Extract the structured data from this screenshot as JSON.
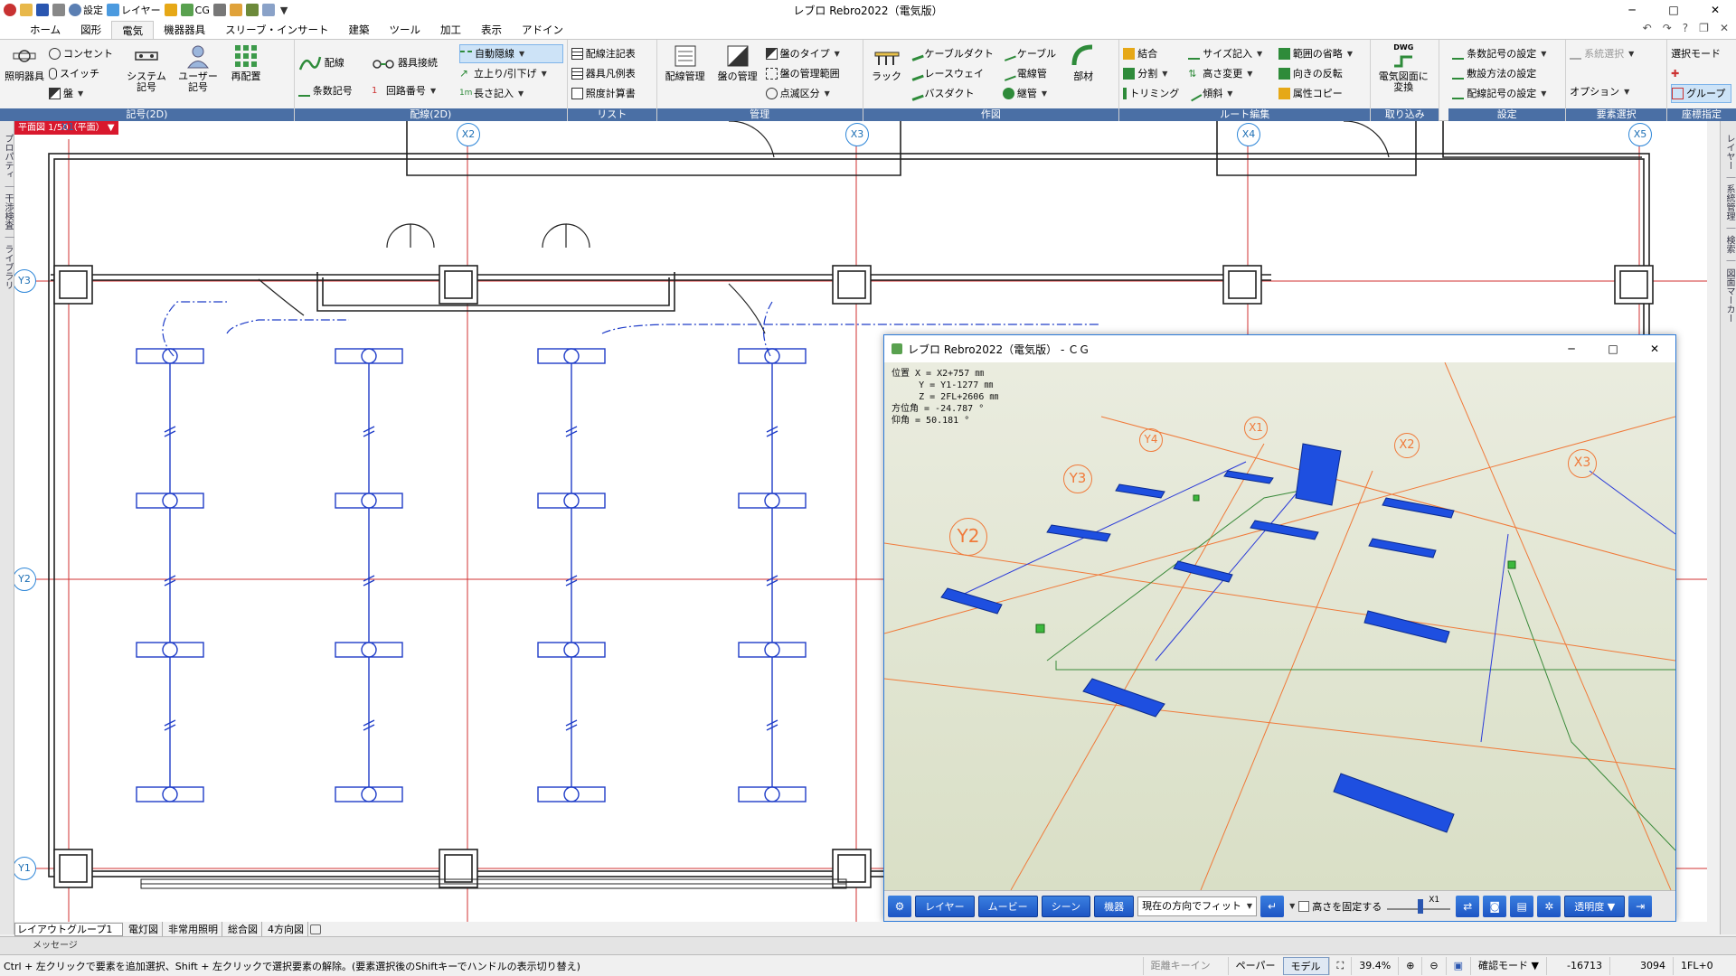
{
  "window": {
    "title": "レブロ Rebro2022（電気版）",
    "quick_access": [
      "設定",
      "レイヤー",
      "CG"
    ]
  },
  "menu_tabs": [
    "ホーム",
    "図形",
    "電気",
    "機器器具",
    "スリーブ・インサート",
    "建築",
    "ツール",
    "加工",
    "表示",
    "アドイン"
  ],
  "active_tab": "電気",
  "ribbon": {
    "kigou": {
      "label": "記号(2D)",
      "big": [
        "照明器具",
        "システム記号",
        "ユーザー記号",
        "再配置"
      ],
      "small": [
        "コンセント",
        "スイッチ",
        "盤"
      ]
    },
    "haisen": {
      "label": "配線(2D)",
      "big": [
        "配線",
        "器具接続"
      ],
      "small": [
        "自動隠線",
        "立上り/引下げ",
        "長さ記入",
        "条数記号",
        "回路番号"
      ]
    },
    "list": {
      "label": "リスト",
      "small": [
        "配線注記表",
        "器具凡例表",
        "照度計算書"
      ]
    },
    "kanri": {
      "label": "管理",
      "big": [
        "配線管理",
        "盤の管理"
      ],
      "small": [
        "盤のタイプ",
        "盤の管理範囲",
        "点滅区分"
      ]
    },
    "sakuzu": {
      "label": "作図",
      "big": [
        "ラック",
        "部材"
      ],
      "small": [
        "ケーブルダクト",
        "ケーブル",
        "レースウェイ",
        "電線管",
        "バスダクト",
        "継管"
      ]
    },
    "route": {
      "label": "ルート編集",
      "small": [
        "結合",
        "サイズ記入",
        "範囲の省略",
        "分割",
        "高さ変更",
        "向きの反転",
        "トリミング",
        "傾斜",
        "属性コピー"
      ]
    },
    "torikomi": {
      "label": "取り込み",
      "big": [
        "電気図面に変換"
      ],
      "badge": "DWG"
    },
    "settei": {
      "label": "設定",
      "small": [
        "条数記号の設定",
        "敷設方法の設定",
        "配線記号の設定"
      ]
    },
    "youso": {
      "label": "要素選択",
      "small": [
        "系統選択",
        "オプション"
      ]
    },
    "zahyo": {
      "label": "座標指定",
      "small": [
        "選択モード",
        "グループ"
      ]
    }
  },
  "left_rail": "プロパティ ｜ 干渉検査 ｜ ライブラリ",
  "right_rail": "レイヤー ｜ 系統管理 ｜ 検索 ｜ 図面マーカー",
  "view_tag": "平面図 1/50（平面）",
  "grid_labels": {
    "x": [
      "X1",
      "X2",
      "X3",
      "X4",
      "X5"
    ],
    "y": [
      "Y1",
      "Y2",
      "Y3"
    ]
  },
  "cg_window": {
    "title": "レブロ Rebro2022（電気版） - ＣＧ",
    "info_lines": [
      "位置 X = X2+757 ㎜",
      "     Y = Y1-1277 ㎜",
      "     Z = 2FL+2606 ㎜",
      "方位角 = -24.787 °",
      "仰角 = 50.181 °"
    ],
    "grid_labels": [
      "Y4",
      "X1",
      "Y3",
      "X2",
      "X3",
      "Y2"
    ],
    "toolbar": {
      "buttons": [
        "レイヤー",
        "ムービー",
        "シーン",
        "機器"
      ],
      "fit_select": "現在の方向でフィット",
      "fix_height": "高さを固定する",
      "scale": "X1",
      "transparency": "透明度"
    }
  },
  "sheet_tabs": {
    "group": "レイアウトグループ1",
    "tabs": [
      "電灯図",
      "非常用照明",
      "総合図",
      "4方向図"
    ]
  },
  "message_bar": "メッセージ",
  "status": {
    "message": "Ctrl + 左クリックで要素を追加選択、Shift + 左クリックで選択要素の解除。(要素選択後のShiftキーでハンドルの表示切り替え)",
    "distance_key": "距離キーイン",
    "paper": "ペーパー",
    "model": "モデル",
    "zoom": "39.4%",
    "confirm_mode": "確認モード",
    "coord_x": "-16713",
    "coord_y": "3094",
    "level": "1FL+0"
  }
}
